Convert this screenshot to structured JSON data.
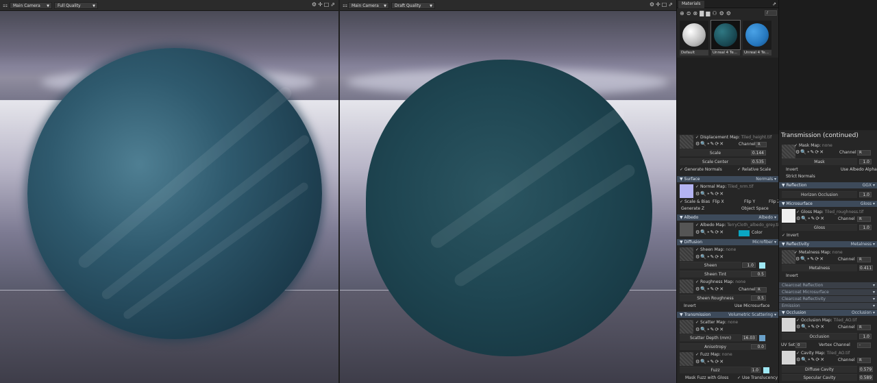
{
  "viewport1": {
    "camera": "Main Camera",
    "quality": "Full Quality"
  },
  "viewport2": {
    "camera": "Main Camera",
    "quality": "Draft Quality"
  },
  "materials": {
    "tab": "Materials",
    "path_label": "/",
    "thumbs": [
      {
        "label": "Default",
        "color": "#d8d8d8"
      },
      {
        "label": "Unreal 4 Te...",
        "color": "#1f5660"
      },
      {
        "label": "Unreal 4 Te...",
        "color": "#2b7fc0"
      }
    ]
  },
  "displacement": {
    "map_label": "Displacement Map:",
    "map_file": "Tiled_height.tif",
    "channel_label": "Channel",
    "channel_value": "R",
    "scale_label": "Scale",
    "scale_value": "0.144",
    "scale_center_label": "Scale Center",
    "scale_center_value": "0.535",
    "generate_normals": "Generate Normals",
    "relative_scale": "Relative Scale"
  },
  "surface": {
    "title": "Surface",
    "type": "Normals",
    "map_label": "Normal Map:",
    "map_file": "Tiled_nrm.tif",
    "scale_bias": "Scale & Bias",
    "flip_x": "Flip X",
    "flip_y": "Flip Y",
    "flip_z": "Flip Z",
    "generate_z": "Generate Z",
    "object_space": "Object Space"
  },
  "albedo": {
    "title": "Albedo",
    "type": "Albedo",
    "map_label": "Albedo Map:",
    "map_file": "TerryCloth_albedo_grey.tif",
    "color_label": "Color",
    "color": "#0aa6c2"
  },
  "diffusion": {
    "title": "Diffusion",
    "type": "Microfiber",
    "sheen_map_label": "Sheen Map:",
    "sheen_map_file": "none",
    "sheen_label": "Sheen",
    "sheen_value": "1.0",
    "sheen_color": "#9fe8f4",
    "sheen_tint_label": "Sheen Tint",
    "sheen_tint_value": "0.5",
    "rough_map_label": "Roughness Map:",
    "rough_map_file": "none",
    "channel_label": "Channel",
    "channel_value": "R",
    "sheen_rough_label": "Sheen Roughness",
    "sheen_rough_value": "0.5",
    "invert": "Invert",
    "use_micro": "Use Microsurface"
  },
  "transmission": {
    "title": "Transmission",
    "type": "Volumetric Scattering",
    "scatter_map_label": "Scatter Map:",
    "scatter_map_file": "none",
    "scatter_depth_label": "Scatter Depth (mm)",
    "scatter_depth_value": "16.03",
    "scatter_color": "#6aa0c8",
    "aniso_label": "Anisotropy",
    "aniso_value": "0.0",
    "fuzz_map_label": "Fuzz Map:",
    "fuzz_map_file": "none",
    "fuzz_label": "Fuzz",
    "fuzz_value": "1.0",
    "fuzz_color": "#9fe8f4",
    "mask_fuzz": "Mask Fuzz with Gloss",
    "use_transl": "Use Translucency"
  },
  "trans_cont": {
    "title": "Transmission (continued)",
    "mask_map_label": "Mask Map:",
    "mask_map_file": "none",
    "channel_label": "Channel",
    "channel_value": "R",
    "mask_label": "Mask",
    "mask_value": "1.0",
    "invert": "Invert",
    "use_albedo_alpha": "Use Albedo Alpha",
    "strict_normals": "Strict Normals"
  },
  "reflection": {
    "title": "Reflection",
    "type": "GGX",
    "horizon_label": "Horizon Occlusion",
    "horizon_value": "1.0"
  },
  "microsurface": {
    "title": "Microsurface",
    "type": "Gloss",
    "map_label": "Gloss Map:",
    "map_file": "Tiled_roughness.tif",
    "channel_label": "Channel",
    "channel_value": "R",
    "gloss_label": "Gloss",
    "gloss_value": "1.0",
    "invert": "Invert"
  },
  "reflectivity": {
    "title": "Reflectivity",
    "type": "Metalness",
    "map_label": "Metalness Map:",
    "map_file": "none",
    "channel_label": "Channel",
    "channel_value": "R",
    "metal_label": "Metalness",
    "metal_value": "0.411",
    "invert": "Invert"
  },
  "clearcoat": [
    "Clearcoat Reflection",
    "Clearcoat Microsurface",
    "Clearcoat Reflectivity"
  ],
  "emission": "Emission",
  "occlusion": {
    "title": "Occlusion",
    "type": "Occlusion",
    "map_label": "Occlusion Map:",
    "map_file": "Tiled_AO.tif",
    "channel_label": "Channel",
    "channel_value": "R",
    "occl_label": "Occlusion",
    "occl_value": "1.0",
    "uvset_label": "UV Set",
    "uvset_value": "0",
    "vertex_label": "Vertex Channel",
    "vertex_value": "-",
    "cavity_map_label": "Cavity Map:",
    "cavity_map_file": "Tiled_AO.tif",
    "diffuse_cav_label": "Diffuse Cavity",
    "diffuse_cav_value": "0.579",
    "spec_cav_label": "Specular Cavity",
    "spec_cav_value": "0.589"
  }
}
